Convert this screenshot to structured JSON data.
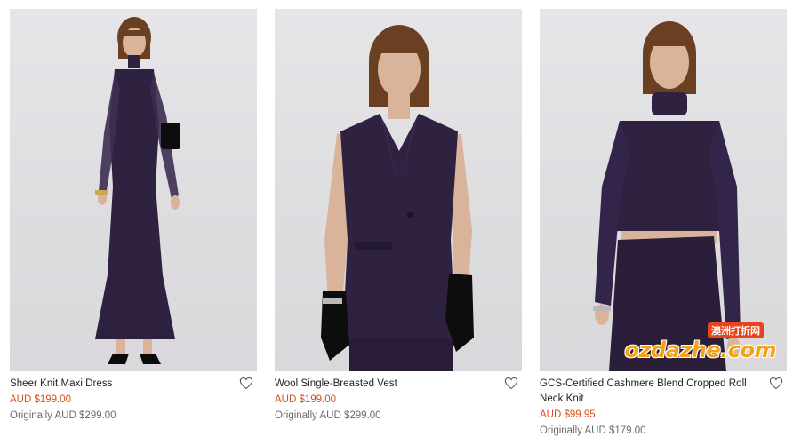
{
  "products": [
    {
      "name": "Sheer Knit Maxi Dress",
      "sale_price": "AUD $199.00",
      "original_price": "Originally AUD $299.00"
    },
    {
      "name": "Wool Single-Breasted Vest",
      "sale_price": "AUD $199.00",
      "original_price": "Originally AUD $299.00"
    },
    {
      "name": "GCS-Certified Cashmere Blend Cropped Roll Neck Knit",
      "sale_price": "AUD $99.95",
      "original_price": "Originally AUD $179.00"
    }
  ],
  "watermark": {
    "brand": "ozdazhe.com",
    "tagline": "澳洲打折网"
  },
  "colors": {
    "sale": "#d3501f",
    "garment": "#2f2140",
    "background": "#e4e3e6"
  },
  "icons": {
    "wishlist": "heart-outline-icon"
  }
}
